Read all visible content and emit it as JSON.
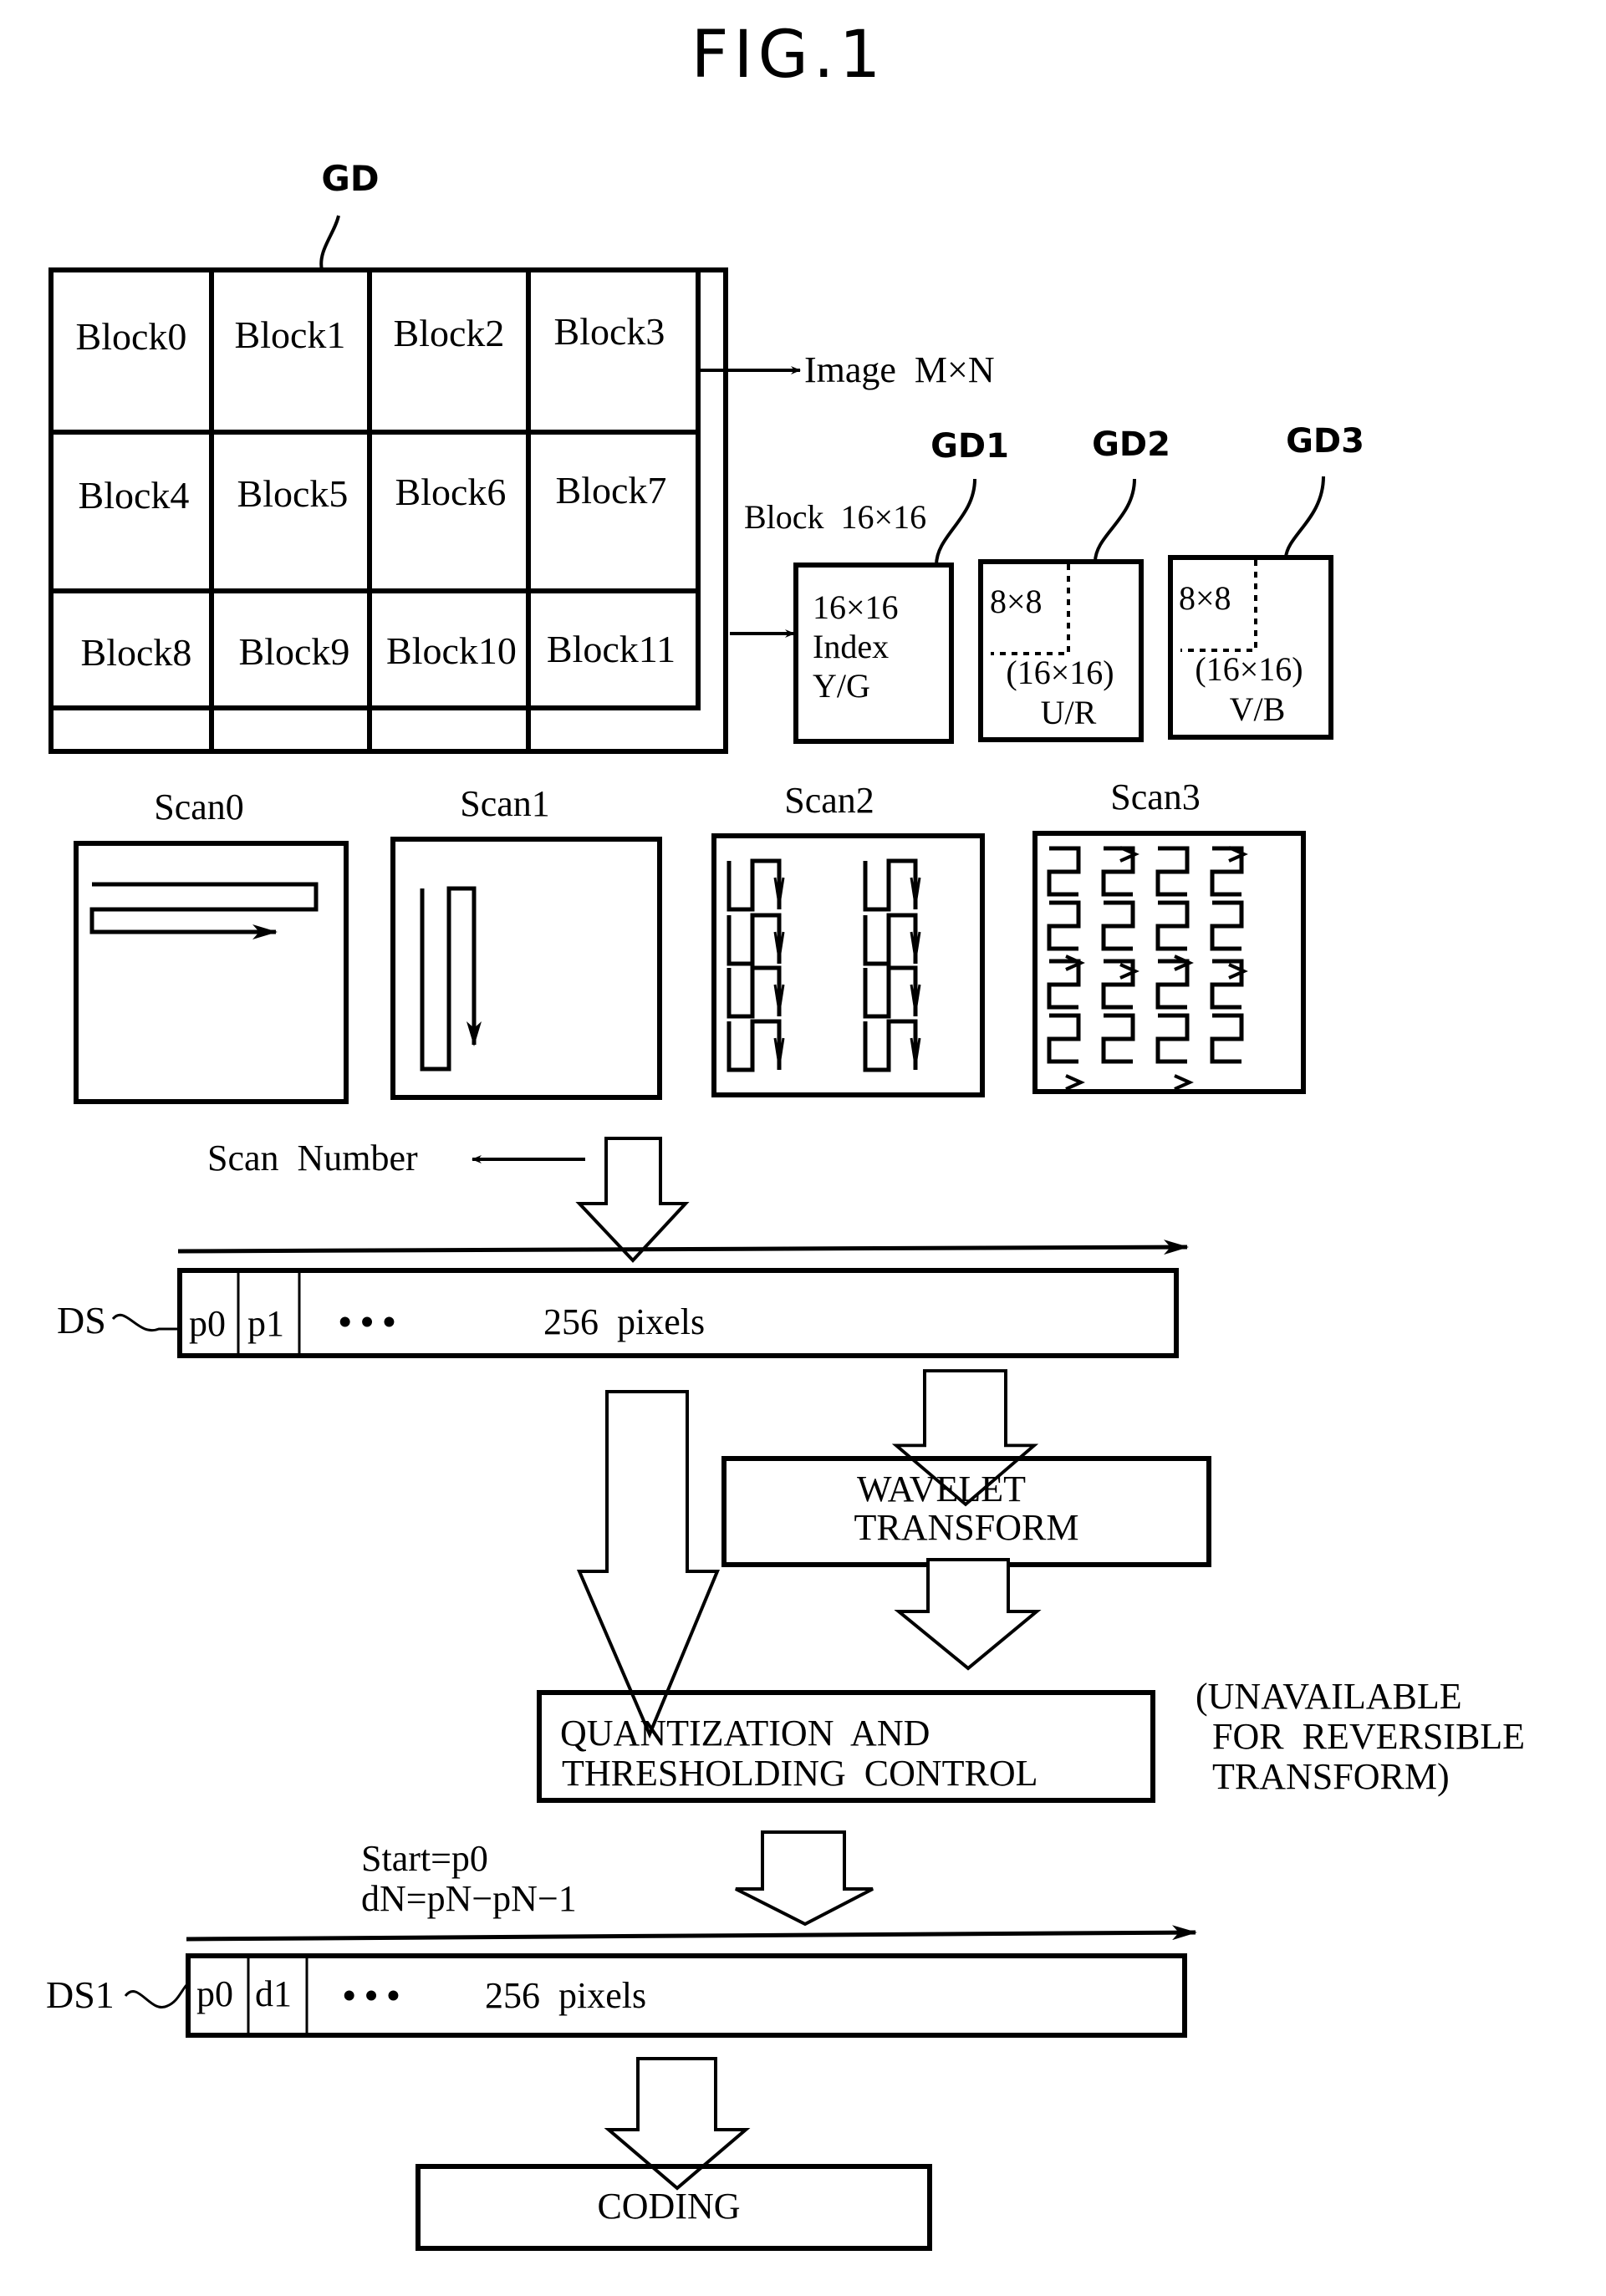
{
  "figure": {
    "title": "FIG.1",
    "image": {
      "ref": "GD",
      "blocks": [
        "Block0",
        "Block1",
        "Block2",
        "Block3",
        "Block4",
        "Block5",
        "Block6",
        "Block7",
        "Block8",
        "Block9",
        "Block10",
        "Block11"
      ],
      "image_label": "Image  M×N",
      "block_label": "Block  16×16"
    },
    "components": [
      {
        "ref": "GD1",
        "lines": [
          "16×16",
          "Index",
          "Y/G"
        ]
      },
      {
        "ref": "GD2",
        "sub": "8×8",
        "lines": [
          "(16×16)",
          "U/R"
        ]
      },
      {
        "ref": "GD3",
        "sub": "8×8",
        "lines": [
          "(16×16)",
          "V/B"
        ]
      }
    ],
    "scans": [
      "Scan0",
      "Scan1",
      "Scan2",
      "Scan3"
    ],
    "scan_number_label": "Scan  Number",
    "ds": {
      "ref": "DS",
      "cells": [
        "p0",
        "p1"
      ],
      "dots": "• • •",
      "text": "256  pixels"
    },
    "wavelet": {
      "line1": "WAVELET",
      "line2": "TRANSFORM"
    },
    "quantization": {
      "line1": "QUANTIZATION  AND",
      "line2": "THRESHOLDING  CONTROL"
    },
    "note": {
      "line1": "(UNAVAILABLE",
      "line2": "FOR  REVERSIBLE",
      "line3": "TRANSFORM)"
    },
    "formula": {
      "line1": "Start=p0",
      "line2": "dN=pN−pN−1"
    },
    "ds1": {
      "ref": "DS1",
      "cells": [
        "p0",
        "d1"
      ],
      "dots": "• • •",
      "text": "256  pixels"
    },
    "coding": "CODING"
  }
}
